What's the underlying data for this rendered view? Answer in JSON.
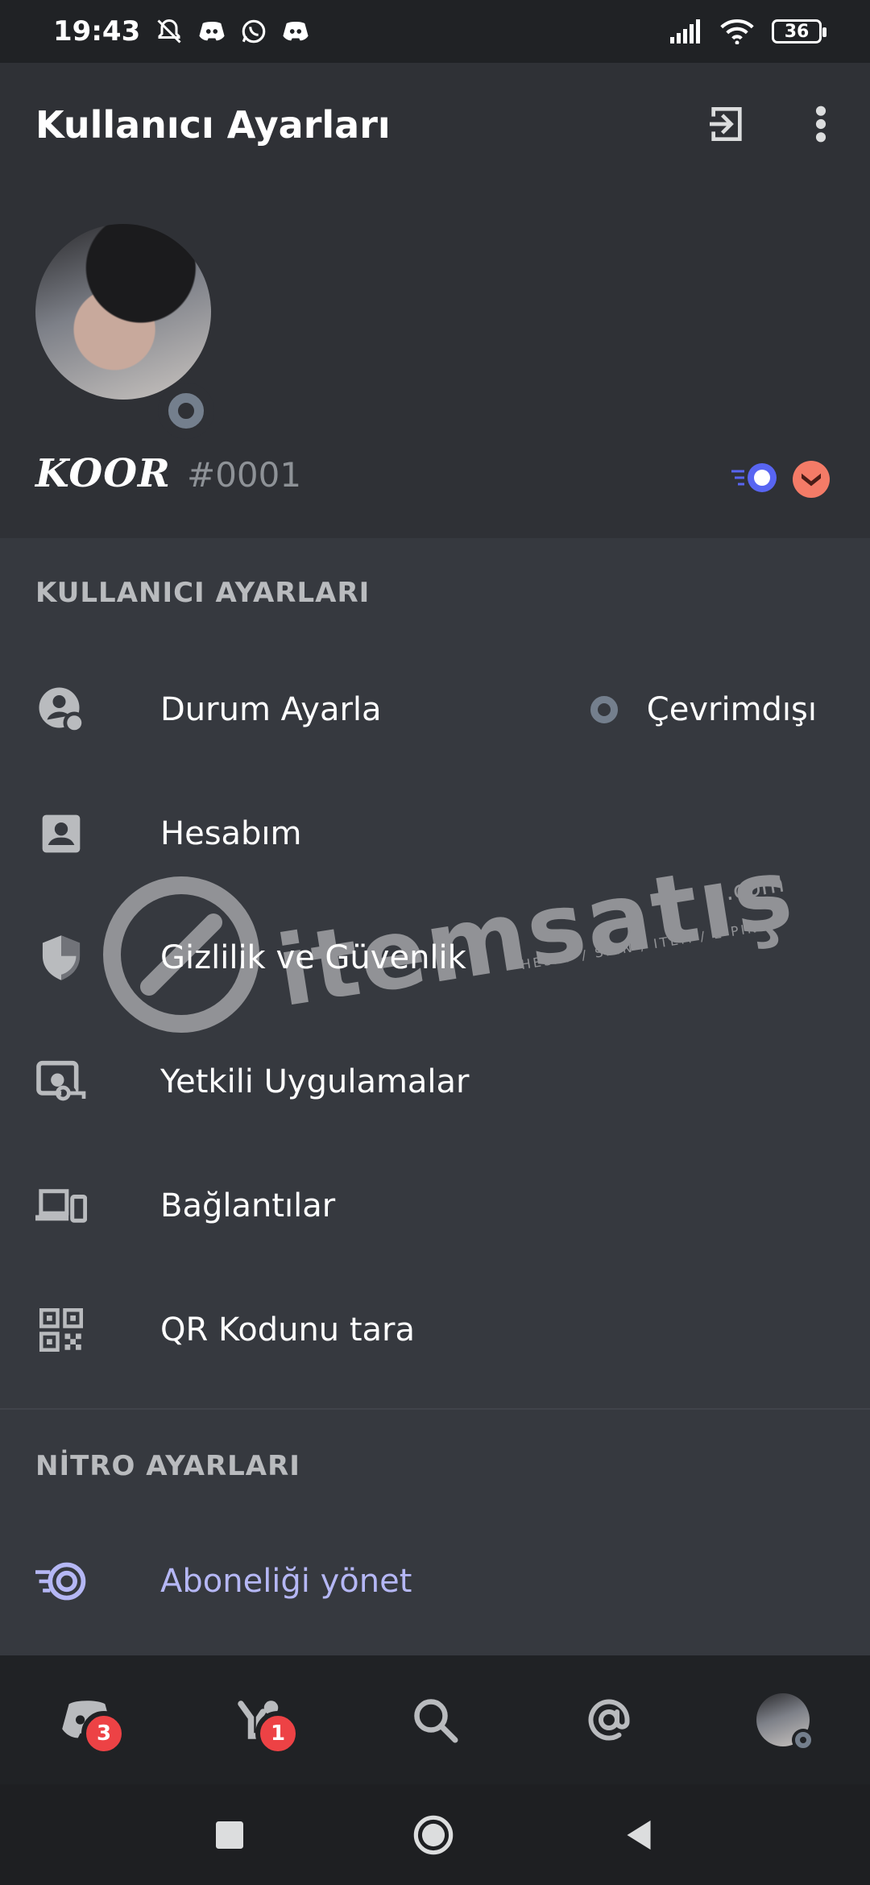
{
  "status_bar": {
    "time": "19:43",
    "battery": "36",
    "icons": [
      "mute-icon",
      "discord-icon",
      "whatsapp-icon",
      "discord-icon",
      "signal-icon",
      "wifi-icon"
    ]
  },
  "header": {
    "title": "Kullanıcı Ayarları",
    "username": "KOOR",
    "discriminator": "#0001",
    "badges": [
      "nitro-badge",
      "hypesquad-badge"
    ]
  },
  "user_settings": {
    "section_label": "KULLANICI AYARLARI",
    "items": [
      {
        "label": "Durum Ayarla",
        "icon": "status-icon",
        "value": "Çevrimdışı"
      },
      {
        "label": "Hesabım",
        "icon": "account-icon"
      },
      {
        "label": "Gizlilik ve Güvenlik",
        "icon": "shield-icon"
      },
      {
        "label": "Yetkili Uygulamalar",
        "icon": "authorized-apps-icon"
      },
      {
        "label": "Bağlantılar",
        "icon": "devices-icon"
      },
      {
        "label": "QR Kodunu tara",
        "icon": "qr-code-icon"
      }
    ]
  },
  "nitro_settings": {
    "section_label": "NİTRO AYARLARI",
    "items": [
      {
        "label": "Aboneliği yönet",
        "icon": "nitro-icon",
        "color": "#b5b7f5"
      }
    ]
  },
  "watermark": {
    "text": "itemsatış",
    "domain": ".com",
    "tagline": "HESAP / SKIN / ITEM / E-PIN"
  },
  "bottom_nav": {
    "items": [
      {
        "icon": "home-discord-icon",
        "badge": "3"
      },
      {
        "icon": "friends-icon",
        "badge": "1"
      },
      {
        "icon": "search-icon"
      },
      {
        "icon": "mentions-icon"
      },
      {
        "icon": "profile-avatar"
      }
    ]
  },
  "colors": {
    "background": "#36393f",
    "header_bg": "#2f3136",
    "nav_bg": "#202225",
    "badge_red": "#ed4245",
    "offline_gray": "#747f8d",
    "nitro_purple": "#b5b7f5"
  }
}
